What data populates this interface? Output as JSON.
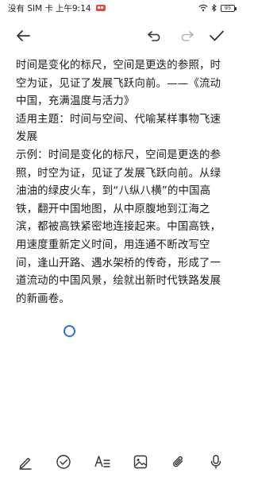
{
  "status_bar": {
    "carrier": "没有 SIM 卡",
    "time": "上午9:14",
    "battery": "95"
  },
  "toolbar": {
    "back_icon": "back-arrow-icon",
    "undo_icon": "undo-icon",
    "redo_icon": "redo-icon",
    "done_icon": "check-icon"
  },
  "note": {
    "lines": [
      "时间是变化的标尺，空间是更迭的参照，时",
      "空为证，见证了发展飞跃向前。——《流动",
      "中国，充满温度与活力》",
      "适用主题：时间与空间、代喻某样事物飞速",
      "发展",
      "示例：时间是变化的标尺，空间是更迭的参",
      "照，时空为证，见证了发展飞跃向前。从绿",
      "油油的绿皮火车，到“八纵八横”的中国高",
      "铁，翻开中国地图，从中原腹地到江海之",
      "滨，都被高铁紧密地连接起来。中国高铁，",
      "用速度重新定义时间，用连通不断改写空",
      "间，逢山开路、遇水架桥的传奇，形成了一",
      "道流动的中国风景，绘就出新时代铁路发展",
      "的新画卷。"
    ]
  },
  "bottom_bar": {
    "icons": [
      "pen-icon",
      "checklist-icon",
      "text-style-icon",
      "image-icon",
      "attachment-icon",
      "microphone-icon"
    ]
  },
  "colors": {
    "accent": "#2a6fdb",
    "text": "#1a1a1a",
    "icon": "#333333",
    "badge": "#e8453c"
  }
}
